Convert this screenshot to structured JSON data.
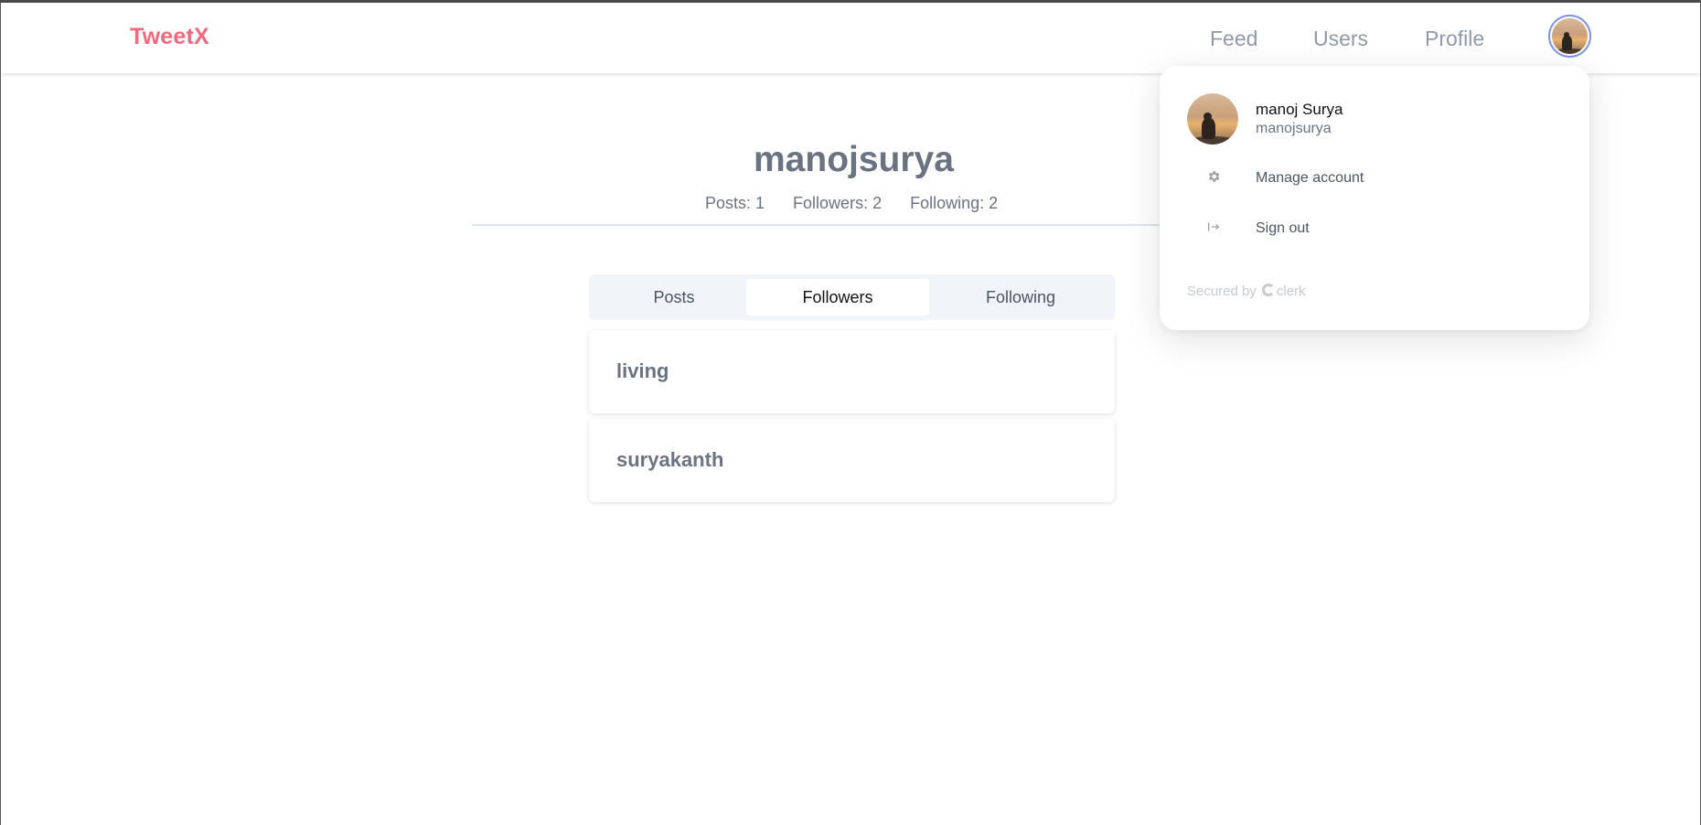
{
  "navbar": {
    "brand": "TweetX",
    "links": [
      {
        "label": "Feed"
      },
      {
        "label": "Users"
      },
      {
        "label": "Profile"
      }
    ]
  },
  "profile": {
    "username": "manojsurya",
    "stats": {
      "posts": "Posts: 1",
      "followers": "Followers: 2",
      "following": "Following: 2"
    }
  },
  "tabs": [
    {
      "label": "Posts"
    },
    {
      "label": "Followers",
      "active": true
    },
    {
      "label": "Following"
    }
  ],
  "followers": [
    {
      "name": "living"
    },
    {
      "name": "suryakanth"
    }
  ],
  "account_menu": {
    "full_name": "manoj Surya",
    "username": "manojsurya",
    "items": [
      {
        "label": "Manage account",
        "icon": "gear-icon"
      },
      {
        "label": "Sign out",
        "icon": "sign-out-icon"
      }
    ],
    "secured_by": "Secured by",
    "brand": "clerk"
  },
  "colors": {
    "brand": "#f0697e",
    "nav_text": "#8f99a8",
    "avatar_ring": "#7f93e6"
  }
}
